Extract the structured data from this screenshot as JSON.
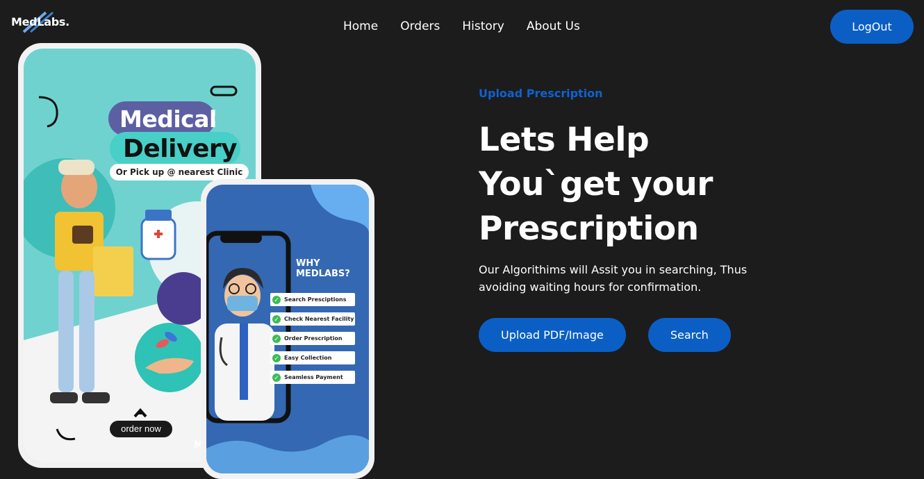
{
  "logo": {
    "text": "MedLabs."
  },
  "nav": {
    "home": "Home",
    "orders": "Orders",
    "history": "History",
    "about": "About Us",
    "logout": "LogOut"
  },
  "hero": {
    "eyebrow": "Upload Prescription",
    "headline_line1": "Lets Help",
    "headline_line2": "You`get your",
    "headline_line3": "Prescription",
    "description": "Our Algorithims will Assit you in searching, Thus avoiding waiting hours for confirmation.",
    "upload_button": "Upload PDF/Image",
    "search_button": "Search"
  },
  "promo_left": {
    "title_line1": "Medical",
    "title_line2": "Delivery",
    "subtitle": "Or Pick up @ nearest Clinic",
    "cta": "order now"
  },
  "promo_right": {
    "heading_line1": "WHY",
    "heading_line2": "MEDLABS?",
    "features": [
      "Search Presciptions",
      "Check Nearest Facility",
      "Order Prescription",
      "Easy Collection",
      "Seamless Payment"
    ]
  },
  "colors": {
    "background": "#1c1c1c",
    "accent": "#0b5fc4",
    "teal": "#6fd2cf",
    "promo_blue": "#3468b3"
  }
}
